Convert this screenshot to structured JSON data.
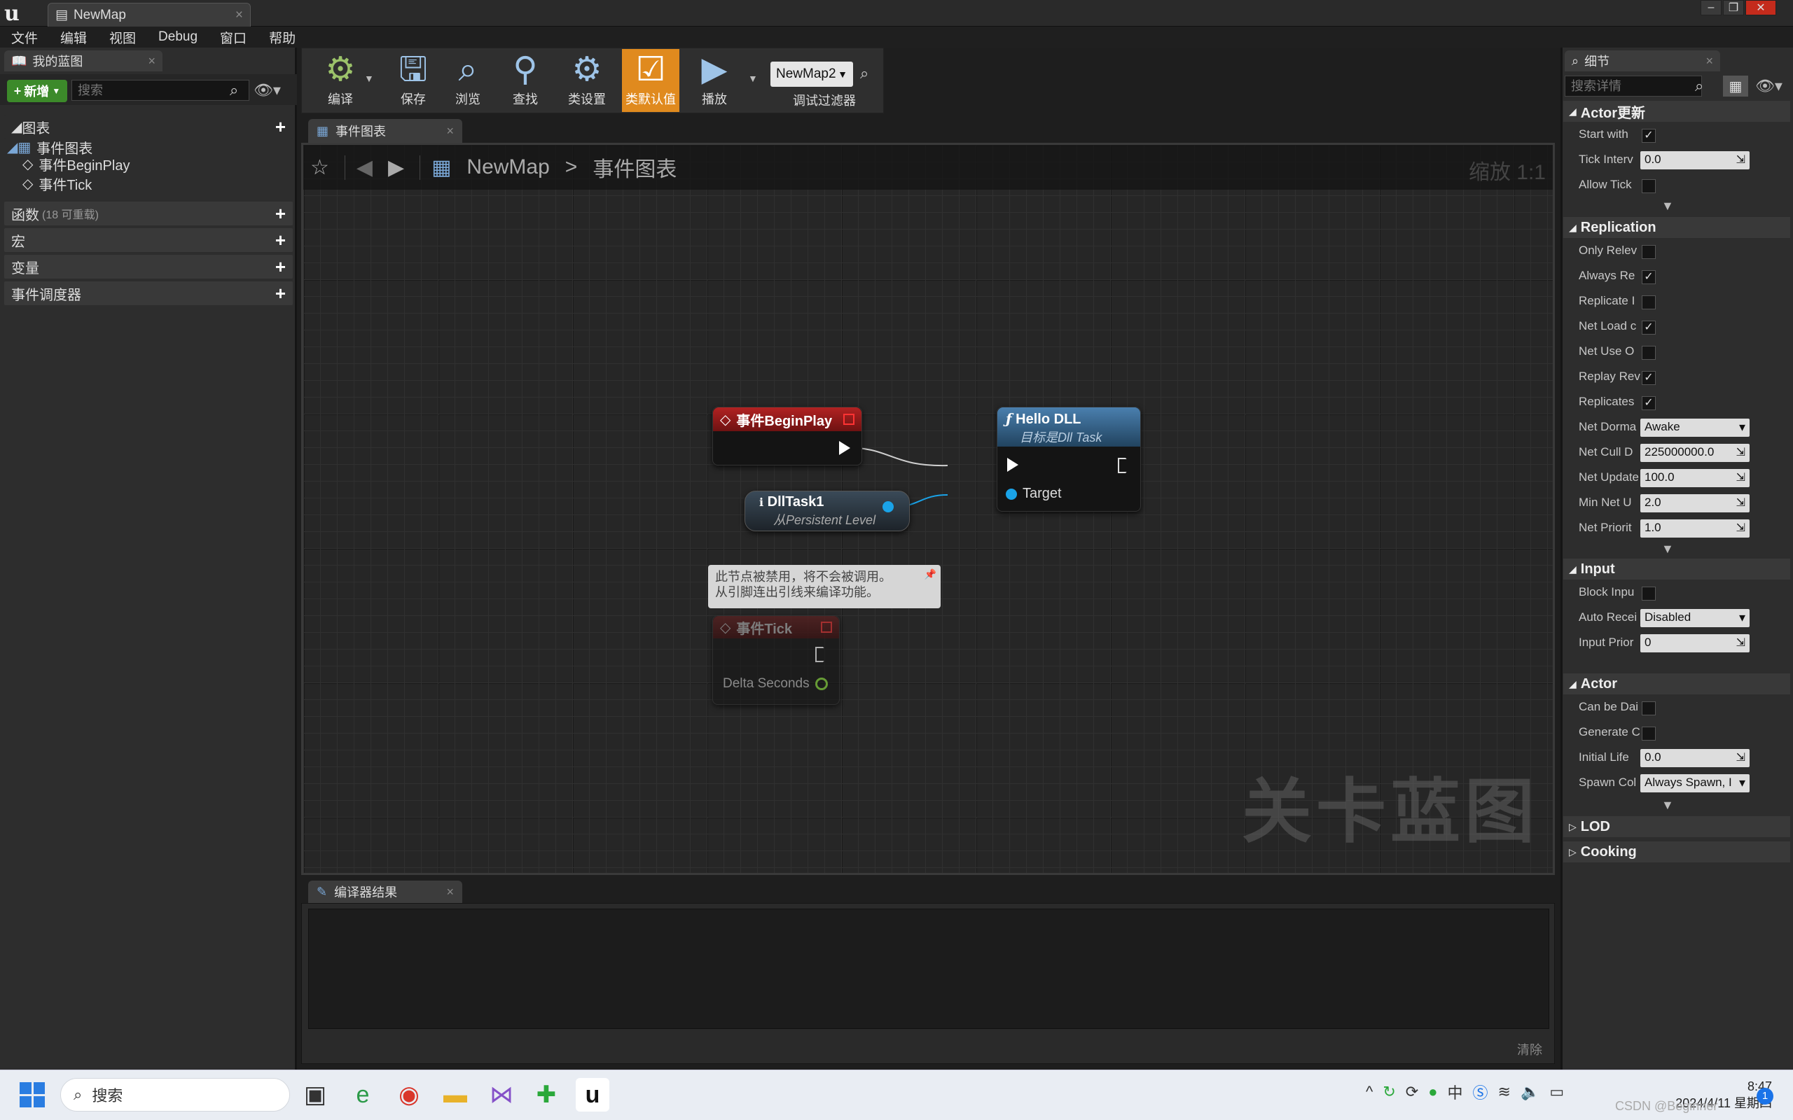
{
  "window": {
    "tab_title": "NewMap"
  },
  "menu": [
    "文件",
    "编辑",
    "视图",
    "Debug",
    "窗口",
    "帮助"
  ],
  "my_blueprint": {
    "tab": "我的蓝图",
    "add_label": "新增",
    "search_placeholder": "搜索",
    "graphs_label": "图表",
    "event_graph": "事件图表",
    "item_beginplay": "事件BeginPlay",
    "item_tick": "事件Tick",
    "functions_label": "函数",
    "functions_count": "(18 可重载)",
    "macros_label": "宏",
    "variables_label": "变量",
    "dispatchers_label": "事件调度器"
  },
  "toolbar": {
    "compile": "编译",
    "save": "保存",
    "browse": "浏览",
    "find": "查找",
    "class_settings": "类设置",
    "class_defaults": "类默认值",
    "play": "播放",
    "debug_object": "NewMap2",
    "debug_filter": "调试过滤器"
  },
  "graph": {
    "tab": "事件图表",
    "breadcrumb_map": "NewMap",
    "breadcrumb_sep": ">",
    "breadcrumb_graph": "事件图表",
    "zoom": "缩放 1:1",
    "watermark": "关卡蓝图",
    "beginplay_title": "事件BeginPlay",
    "hello_title": "Hello DLL",
    "hello_subtitle": "目标是Dll Task",
    "hello_target": "Target",
    "dlltask_title": "DllTask1",
    "dlltask_subtitle": "从Persistent Level",
    "disabled_comment_1": "此节点被禁用，将不会被调用。",
    "disabled_comment_2": "从引脚连出引线来编译功能。",
    "tick_title": "事件Tick",
    "tick_pin": "Delta Seconds"
  },
  "compiler": {
    "tab": "编译器结果",
    "clear": "清除"
  },
  "details": {
    "tab": "细节",
    "search_placeholder": "搜索详情",
    "sections": {
      "actor_tick": "Actor更新",
      "replication": "Replication",
      "input": "Input",
      "actor": "Actor",
      "lod": "LOD",
      "cooking": "Cooking"
    },
    "actor_tick": [
      {
        "label": "Start with",
        "type": "check",
        "value": "✓"
      },
      {
        "label": "Tick Interv",
        "type": "input",
        "value": "0.0"
      },
      {
        "label": "Allow Tick",
        "type": "check",
        "value": ""
      }
    ],
    "replication": [
      {
        "label": "Only Relev",
        "type": "check",
        "value": ""
      },
      {
        "label": "Always Re",
        "type": "check",
        "value": "✓"
      },
      {
        "label": "Replicate I",
        "type": "check",
        "value": ""
      },
      {
        "label": "Net Load c",
        "type": "check",
        "value": "✓"
      },
      {
        "label": "Net Use O",
        "type": "check",
        "value": ""
      },
      {
        "label": "Replay Rev",
        "type": "check",
        "value": "✓"
      },
      {
        "label": "Replicates",
        "type": "check",
        "value": "✓"
      },
      {
        "label": "Net Dorma",
        "type": "select",
        "value": "Awake"
      },
      {
        "label": "Net Cull D",
        "type": "input",
        "value": "225000000.0"
      },
      {
        "label": "Net Update",
        "type": "input",
        "value": "100.0"
      },
      {
        "label": "Min Net U",
        "type": "input",
        "value": "2.0"
      },
      {
        "label": "Net Priorit",
        "type": "input",
        "value": "1.0"
      }
    ],
    "input": [
      {
        "label": "Block Inpu",
        "type": "check",
        "value": ""
      },
      {
        "label": "Auto Recei",
        "type": "select",
        "value": "Disabled"
      },
      {
        "label": "Input Prior",
        "type": "input",
        "value": "0"
      }
    ],
    "actor": [
      {
        "label": "Can be Dai",
        "type": "check",
        "value": ""
      },
      {
        "label": "Generate C",
        "type": "check",
        "value": ""
      },
      {
        "label": "Initial Life",
        "type": "input",
        "value": "0.0"
      },
      {
        "label": "Spawn Col",
        "type": "select",
        "value": "Always Spawn, I"
      }
    ]
  },
  "taskbar": {
    "search": "搜索",
    "time": "8:47",
    "date": "2024/4/11 星期四",
    "notifications": "1",
    "ime": "中",
    "watermark": "CSDN @Beginner"
  },
  "colors": {
    "accent_orange": "#e08a1e",
    "event_red": "#8e1a1a",
    "function_blue": "#2f5d85",
    "add_green": "#3c8a2a"
  }
}
